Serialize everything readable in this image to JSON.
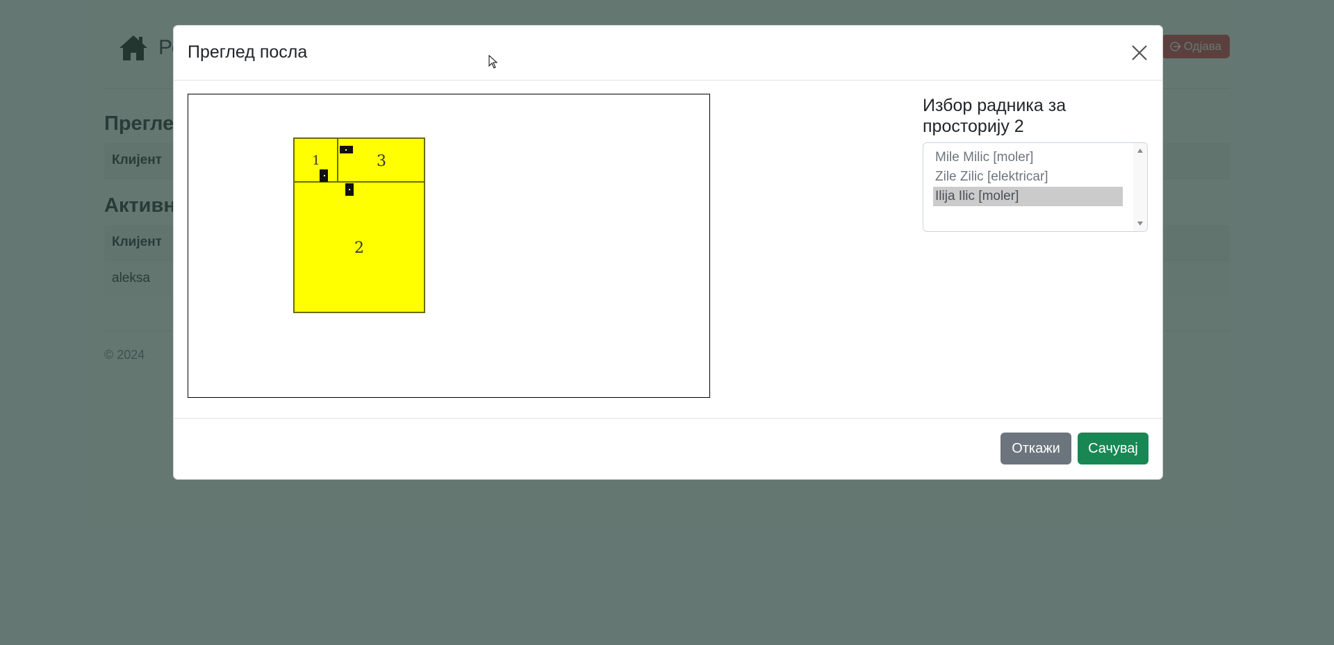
{
  "background": {
    "brand_text": "Ре",
    "logout_label": "Одјава",
    "section1_title": "Прегле",
    "section2_title": "Активн",
    "table1_header": "Клијент",
    "table2_header": "Клијент",
    "table2_row1": "aleksa",
    "footer": "© 2024"
  },
  "modal": {
    "title": "Преглед посла",
    "picker_title": "Избор радника за просторију 2",
    "workers": [
      {
        "label": "Mile Milic [moler]",
        "selected": false
      },
      {
        "label": "Zile Zilic [elektricar]",
        "selected": false
      },
      {
        "label": "Ilija Ilic [moler]",
        "selected": true
      }
    ],
    "cancel_label": "Откажи",
    "save_label": "Сачувај",
    "rooms": [
      {
        "label": "1"
      },
      {
        "label": "3"
      },
      {
        "label": "2"
      }
    ]
  },
  "colors": {
    "room_fill": "#ffff00",
    "save_button": "#198754",
    "cancel_button": "#6c757d",
    "logout_button": "#dc3545"
  }
}
